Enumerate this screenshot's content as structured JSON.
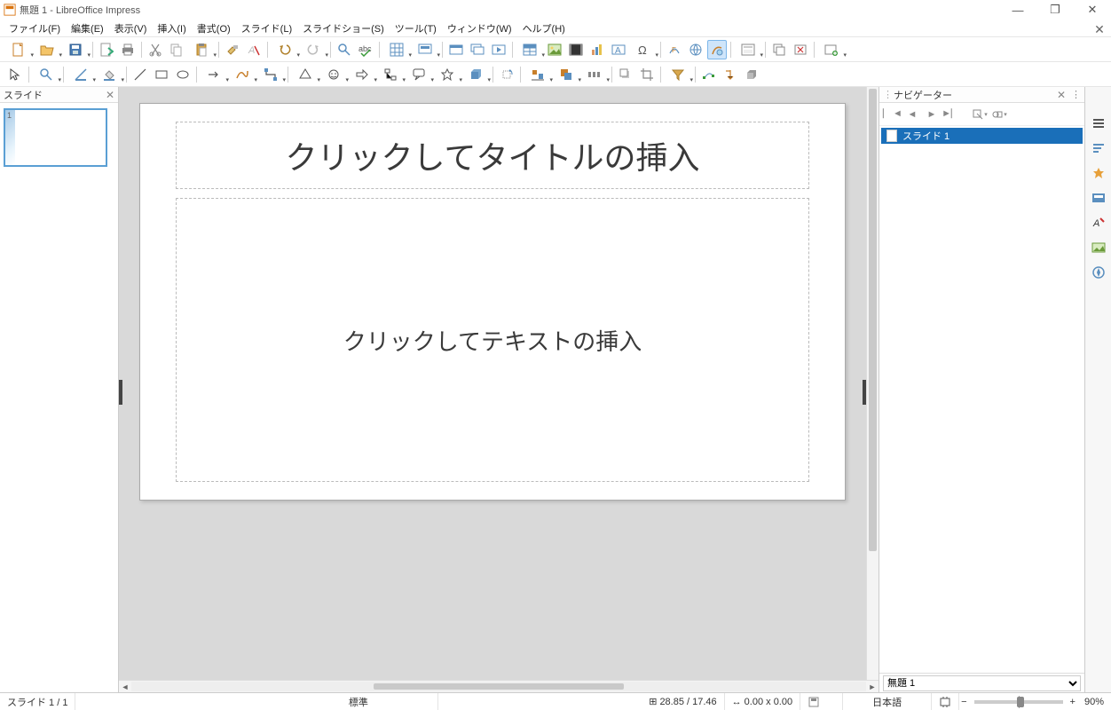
{
  "window": {
    "title": "無題 1 - LibreOffice Impress"
  },
  "menus": [
    {
      "id": "file",
      "label": "ファイル(F)"
    },
    {
      "id": "edit",
      "label": "編集(E)"
    },
    {
      "id": "view",
      "label": "表示(V)"
    },
    {
      "id": "insert",
      "label": "挿入(I)"
    },
    {
      "id": "format",
      "label": "書式(O)"
    },
    {
      "id": "slide",
      "label": "スライド(L)"
    },
    {
      "id": "slideshow",
      "label": "スライドショー(S)"
    },
    {
      "id": "tools",
      "label": "ツール(T)"
    },
    {
      "id": "window",
      "label": "ウィンドウ(W)"
    },
    {
      "id": "help",
      "label": "ヘルプ(H)"
    }
  ],
  "slide_panel": {
    "title": "スライド",
    "thumb_number": "1"
  },
  "canvas": {
    "title_placeholder": "クリックしてタイトルの挿入",
    "text_placeholder": "クリックしてテキストの挿入"
  },
  "navigator": {
    "title": "ナビゲーター",
    "item_label": "スライド 1",
    "doc_selector": "無題 1"
  },
  "statusbar": {
    "slide_count": "スライド 1 / 1",
    "mode": "標準",
    "coords": "28.85 / 17.46",
    "size": "0.00 x 0.00",
    "lang": "日本語",
    "zoom": "90%"
  }
}
